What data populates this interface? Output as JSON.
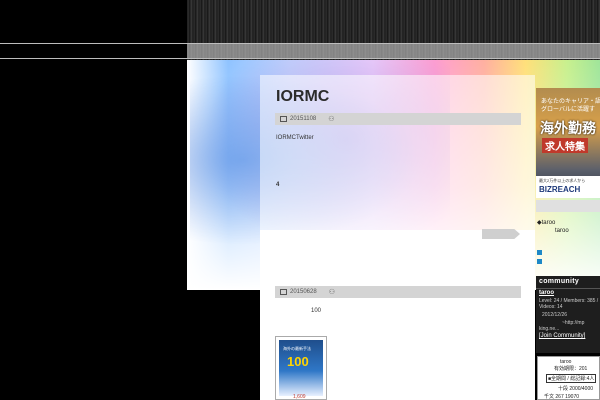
{
  "post": {
    "title": "IORMC",
    "date1": "20151108",
    "text1": "IORMCTwitter",
    "bold_number": "4",
    "date2": "20150628",
    "number": "100",
    "price": "1,609"
  },
  "book": {
    "big_number": "100",
    "subtitle": "海外の最新手法"
  },
  "ad": {
    "line1": "あなたのキャリア・語",
    "line2": "グローバルに活躍す",
    "big": "海外勤務",
    "mid": "求人特集",
    "foot_small": "最大2万件以上の求人から",
    "brand": "BIZREACH"
  },
  "sidebar": {
    "link1": "◆taroo",
    "link2": "taroo"
  },
  "community": {
    "header": "community",
    "name": "taroo",
    "stat1": "Level: 24 / Members: 385 /",
    "stat2": "Videos: 14",
    "date": "2012/12/26",
    "url": "~http://mp",
    "desc": "king.ne...",
    "join": "[Join Community]"
  },
  "table": {
    "t1": "taroo",
    "t2": "有効期限：201",
    "t3": "■全期間 / 総記録:4人",
    "t4": "十段 2000/4000",
    "t5": "千文 267  19070"
  }
}
